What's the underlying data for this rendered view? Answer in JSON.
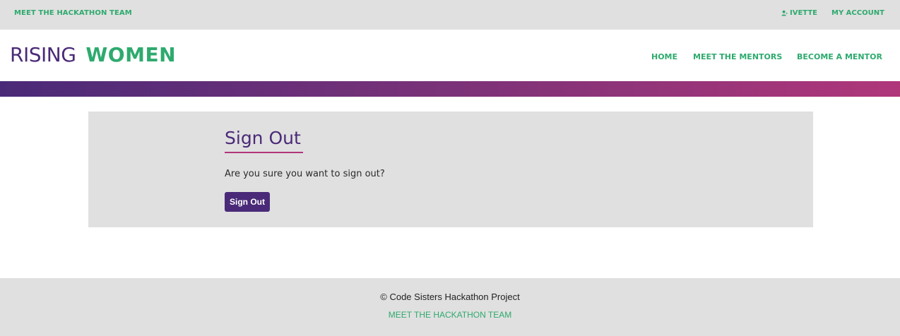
{
  "topbar": {
    "team_link": "MEET THE HACKATHON TEAM",
    "user_name": "IVETTE",
    "user_icon": "user-icon",
    "account_link": "MY ACCOUNT"
  },
  "logo": {
    "part1": "RISING",
    "part2": "WOMEN"
  },
  "nav": {
    "items": [
      {
        "label": "HOME"
      },
      {
        "label": "MEET THE MENTORS"
      },
      {
        "label": "BECOME A MENTOR"
      }
    ]
  },
  "main": {
    "title": "Sign Out",
    "question": "Are you sure you want to sign out?",
    "button_label": "Sign Out"
  },
  "footer": {
    "copyright": "© Code Sisters Hackathon Project",
    "team_link": "MEET THE HACKATHON TEAM"
  },
  "colors": {
    "brand_purple": "#4a2a78",
    "brand_green": "#2eaa6e",
    "accent_pink": "#b0367a",
    "panel_gray": "#e0e0e0"
  }
}
